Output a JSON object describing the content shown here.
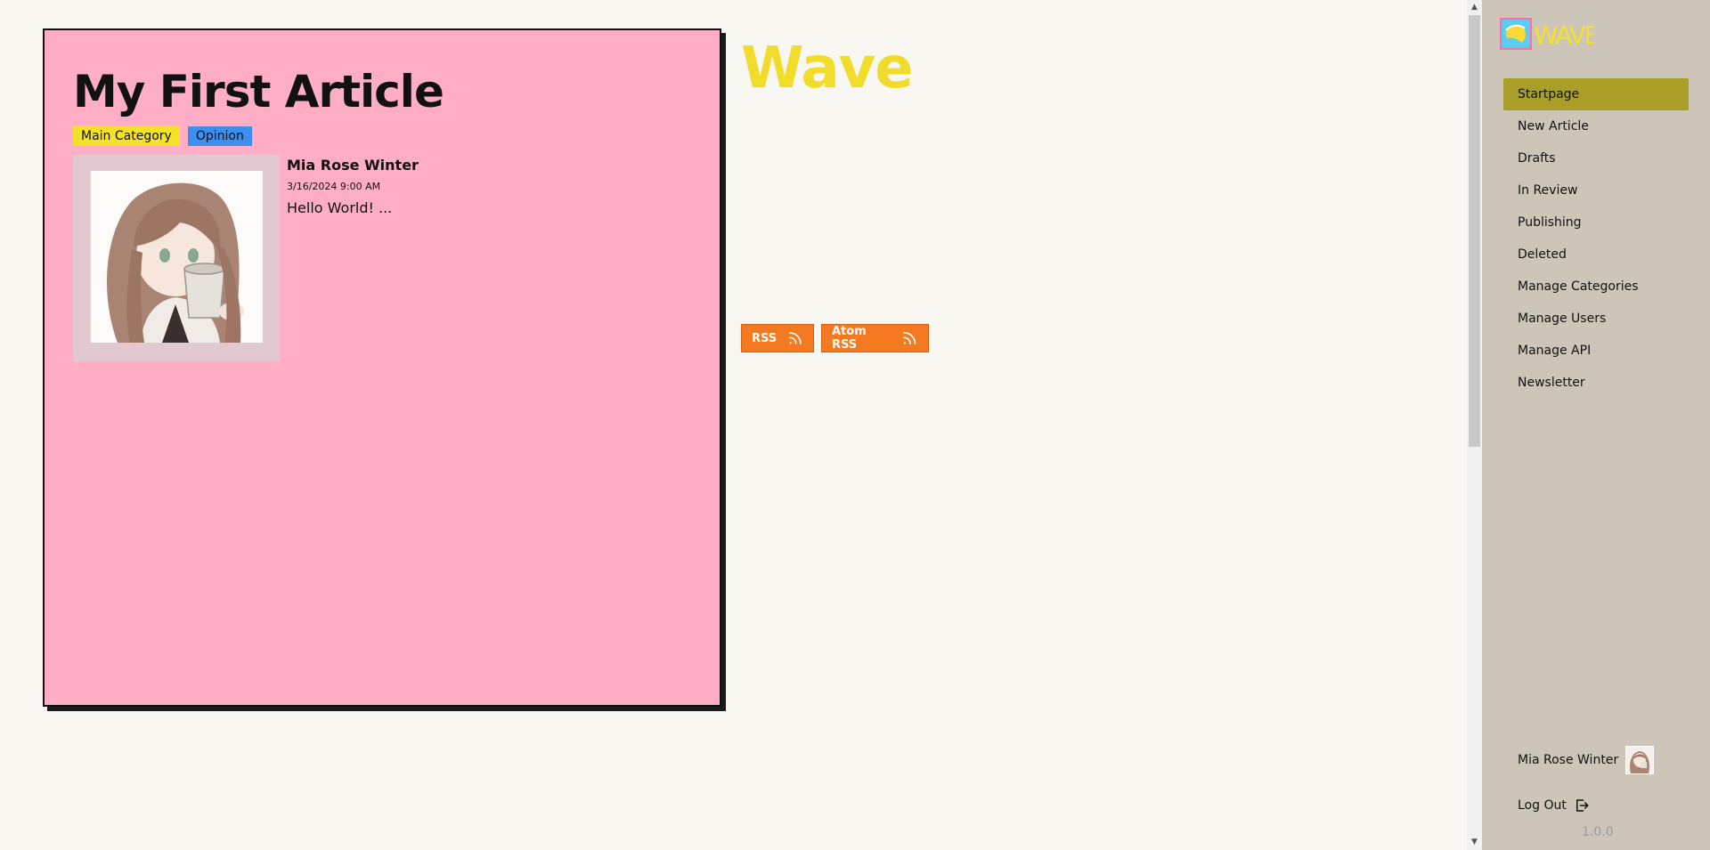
{
  "article": {
    "title": "My First Article",
    "categories": [
      {
        "label": "Main Category",
        "color": "#f4e12a"
      },
      {
        "label": "Opinion",
        "color": "#3d8fef"
      }
    ],
    "author": "Mia Rose Winter",
    "date": "3/16/2024 9:00 AM",
    "excerpt": "Hello World! ..."
  },
  "site": {
    "title": "Wave",
    "feeds": {
      "rss_label": "RSS",
      "atom_label": "Atom RSS"
    }
  },
  "sidebar": {
    "logo_text": "WAVE",
    "nav": [
      {
        "label": "Startpage",
        "active": true
      },
      {
        "label": "New Article"
      },
      {
        "label": "Drafts"
      },
      {
        "label": "In Review"
      },
      {
        "label": "Publishing"
      },
      {
        "label": "Deleted"
      },
      {
        "label": "Manage Categories"
      },
      {
        "label": "Manage Users"
      },
      {
        "label": "Manage API"
      },
      {
        "label": "Newsletter"
      }
    ],
    "user_name": "Mia Rose Winter",
    "logout_label": "Log Out",
    "version": "1.0.0"
  },
  "colors": {
    "card_bg": "#ffaec6",
    "site_title": "#f1dc2c",
    "feed_button": "#f47920",
    "sidebar_bg": "#cdc6b8",
    "nav_active": "#a89e28"
  }
}
